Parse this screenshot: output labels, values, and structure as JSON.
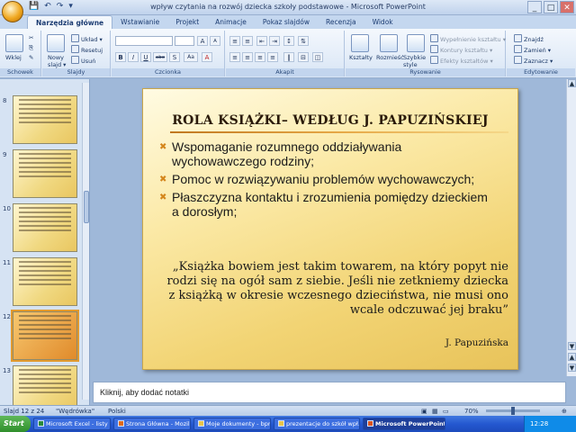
{
  "window": {
    "title": "wpływ czytania na rozwój dziecka szkoły podstawowe - Microsoft PowerPoint",
    "controls": [
      "_",
      "□",
      "✕"
    ]
  },
  "qat": [
    "💾",
    "↶",
    "↷",
    "▾"
  ],
  "tabs": [
    "Narzędzia główne",
    "Wstawianie",
    "Projekt",
    "Animacje",
    "Pokaz slajdów",
    "Recenzja",
    "Widok"
  ],
  "ribbon": {
    "clipboard": {
      "paste": "Wklej",
      "label": "Schowek"
    },
    "slides": {
      "new_slide": "Nowy slajd ▾",
      "layout": "Układ ▾",
      "reset": "Resetuj",
      "delete": "Usuń",
      "label": "Slajdy"
    },
    "font": {
      "label": "Czcionka",
      "bold": "B",
      "italic": "I",
      "underline": "U",
      "strike": "abe",
      "shadow": "S",
      "grow": "A",
      "shrink": "A",
      "clear": "Aa"
    },
    "paragraph": {
      "label": "Akapit"
    },
    "drawing": {
      "shapes": "Kształty",
      "arrange": "Rozmieść",
      "styles": "Szybkie style",
      "fill": "Wypełnienie kształtu ▾",
      "outline": "Kontury kształtu ▾",
      "effects": "Efekty kształtów ▾",
      "label": "Rysowanie"
    },
    "editing": {
      "find": "Znajdź",
      "replace": "Zamień ▾",
      "select": "Zaznacz ▾",
      "label": "Edytowanie"
    }
  },
  "thumbnails": [
    {
      "num": "8",
      "selected": false
    },
    {
      "num": "9",
      "selected": false
    },
    {
      "num": "10",
      "selected": false
    },
    {
      "num": "11",
      "selected": false
    },
    {
      "num": "12",
      "selected": true
    },
    {
      "num": "13",
      "selected": false
    }
  ],
  "slide": {
    "title": "ROLA KSIĄŻKI– WEDŁUG J. PAPUZIŃSKIEJ",
    "bullet_marker": "✖",
    "bullets": [
      "Wspomaganie rozumnego oddziaływania wychowawczego rodziny;",
      "Pomoc w rozwiązywaniu problemów wychowawczych;",
      "Płaszczyzna kontaktu i zrozumienia pomiędzy dzieckiem a dorosłym;"
    ],
    "quote": "„Książka bowiem jest takim towarem, na który popyt nie rodzi się na ogół sam z siebie. Jeśli nie zetkniemy dziecka z książką w okresie wczesnego dzieciństwa, nie musi ono wcale odczuwać jej braku”",
    "author": "J. Papuzińska"
  },
  "notes_placeholder": "Kliknij, aby dodać notatki",
  "status": {
    "slide": "Slajd 12 z 24",
    "theme": "\"Wędrówka\"",
    "language": "Polski",
    "zoom": "70%",
    "zoom_level": 0.7
  },
  "taskbar": {
    "start": "Start",
    "items": [
      {
        "label": "Microsoft Excel - listy zak...",
        "active": false
      },
      {
        "label": "Strona Główna - Mozilla...",
        "active": false
      },
      {
        "label": "Moje dokumenty - bpmia...",
        "active": false
      },
      {
        "label": "prezentacje do szkół wpł...",
        "active": false
      },
      {
        "label": "Microsoft PowerPoint ...",
        "active": true
      }
    ],
    "clock": "12:28"
  }
}
